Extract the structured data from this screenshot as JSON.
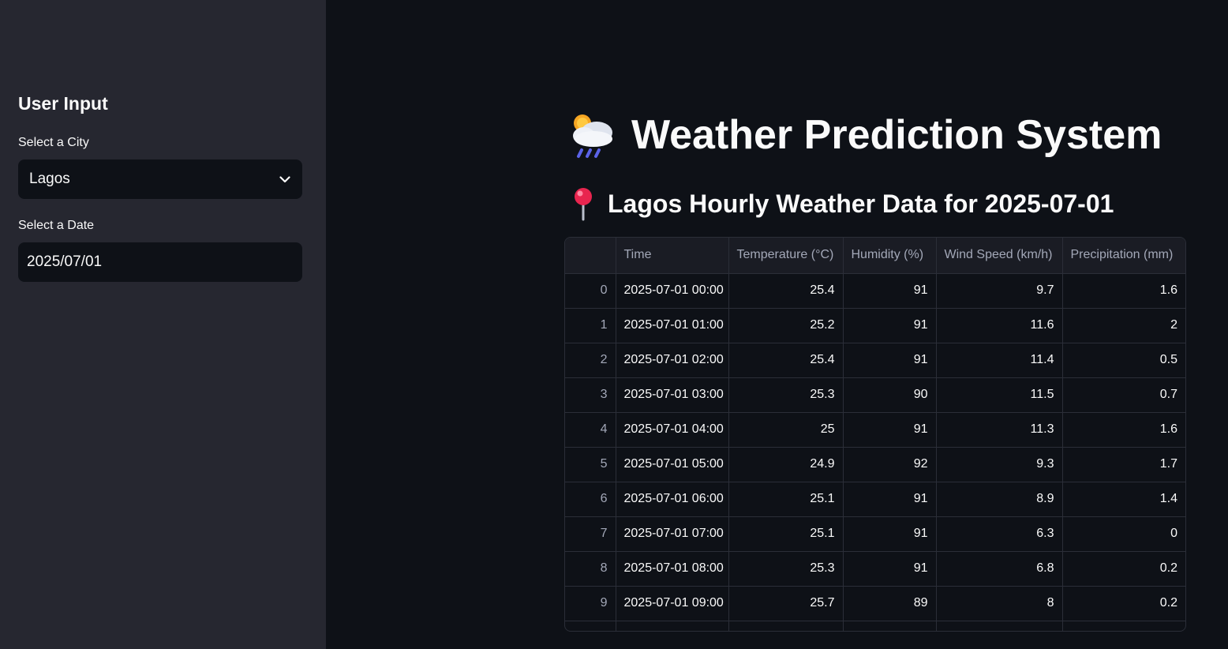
{
  "sidebar": {
    "heading": "User Input",
    "city_label": "Select a City",
    "city_value": "Lagos",
    "date_label": "Select a Date",
    "date_value": "2025/07/01"
  },
  "main": {
    "title": "Weather Prediction System",
    "subtitle": "Lagos Hourly Weather Data for 2025-07-01",
    "title_icon": "cloud-rain-sun-icon",
    "subtitle_icon": "pushpin-icon"
  },
  "table": {
    "columns": [
      "",
      "Time",
      "Temperature (°C)",
      "Humidity (%)",
      "Wind Speed (km/h)",
      "Precipitation (mm)"
    ],
    "rows": [
      [
        "0",
        "2025-07-01 00:00",
        "25.4",
        "91",
        "9.7",
        "1.6"
      ],
      [
        "1",
        "2025-07-01 01:00",
        "25.2",
        "91",
        "11.6",
        "2"
      ],
      [
        "2",
        "2025-07-01 02:00",
        "25.4",
        "91",
        "11.4",
        "0.5"
      ],
      [
        "3",
        "2025-07-01 03:00",
        "25.3",
        "90",
        "11.5",
        "0.7"
      ],
      [
        "4",
        "2025-07-01 04:00",
        "25",
        "91",
        "11.3",
        "1.6"
      ],
      [
        "5",
        "2025-07-01 05:00",
        "24.9",
        "92",
        "9.3",
        "1.7"
      ],
      [
        "6",
        "2025-07-01 06:00",
        "25.1",
        "91",
        "8.9",
        "1.4"
      ],
      [
        "7",
        "2025-07-01 07:00",
        "25.1",
        "91",
        "6.3",
        "0"
      ],
      [
        "8",
        "2025-07-01 08:00",
        "25.3",
        "91",
        "6.8",
        "0.2"
      ],
      [
        "9",
        "2025-07-01 09:00",
        "25.7",
        "89",
        "8",
        "0.2"
      ],
      [
        "",
        "",
        "",
        "",
        "",
        ""
      ]
    ]
  },
  "colors": {
    "background": "#0e1117",
    "sidebar": "#262730",
    "text": "#fafafa",
    "muted": "#a3a8b8",
    "border": "#2b2e38"
  }
}
